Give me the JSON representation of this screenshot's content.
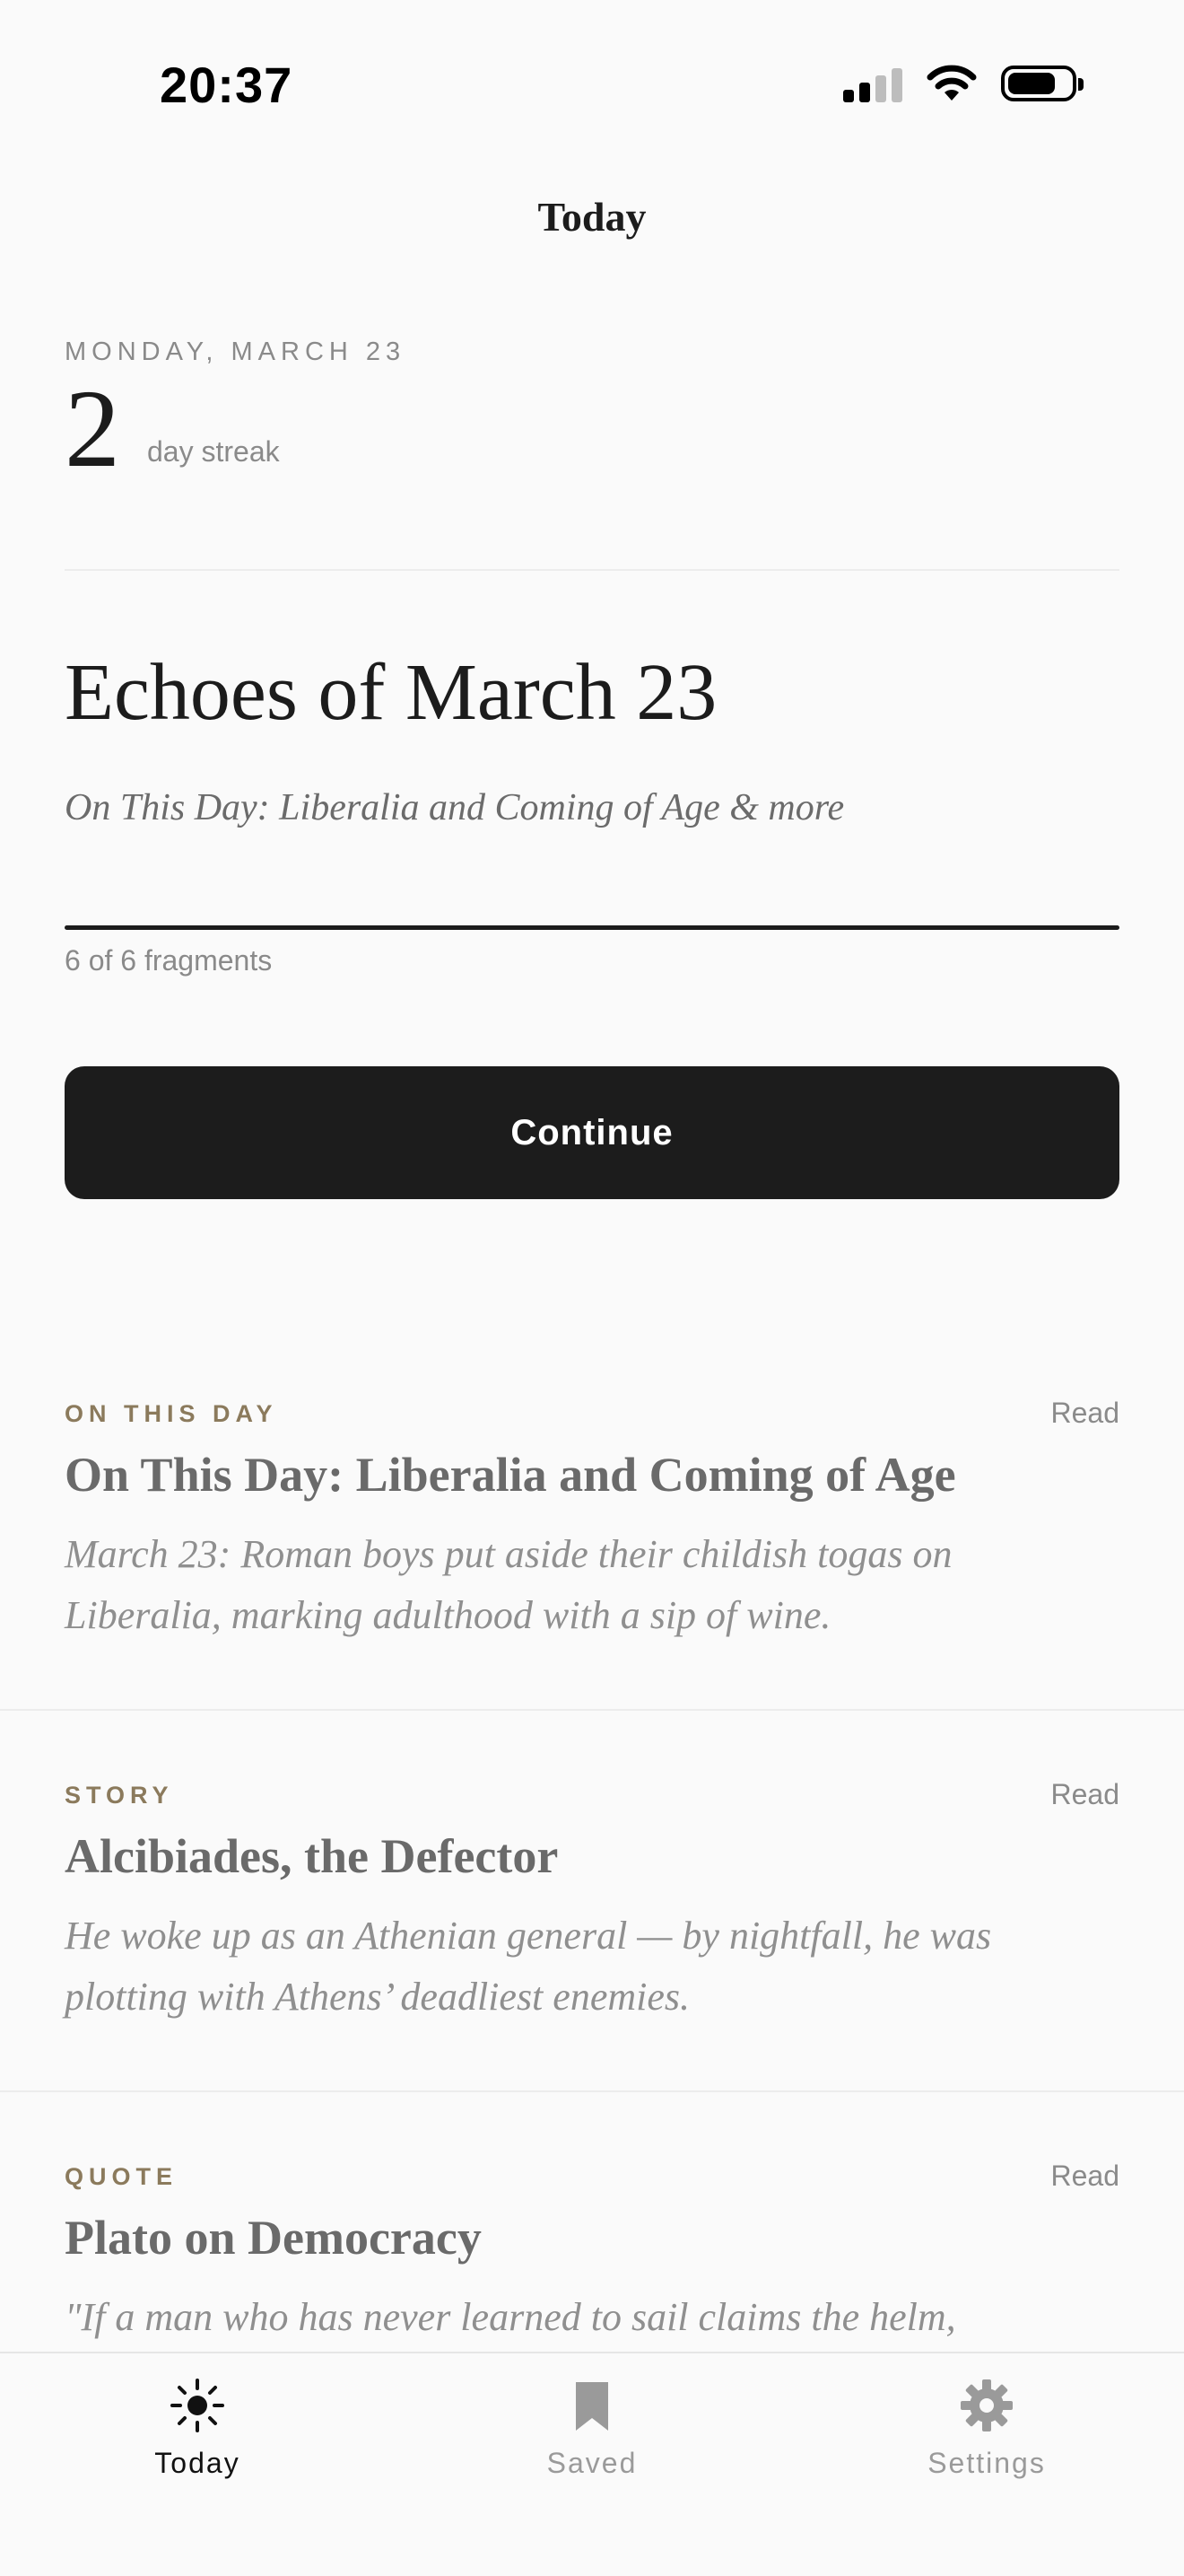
{
  "status_bar": {
    "time": "20:37"
  },
  "nav": {
    "title": "Today"
  },
  "header": {
    "date_label": "MONDAY, MARCH 23",
    "streak_count": "2",
    "streak_label": "day streak"
  },
  "echo": {
    "title": "Echoes of March 23",
    "subtitle": "On This Day: Liberalia and Coming of Age & more",
    "progress_fraction": 1.0,
    "progress_label": "6 of 6 fragments",
    "continue_label": "Continue"
  },
  "cards": [
    {
      "category": "ON THIS DAY",
      "read_label": "Read",
      "title": "On This Day: Liberalia and Coming of Age",
      "description": "March 23: Roman boys put aside their childish togas on Liberalia, marking adulthood with a sip of wine."
    },
    {
      "category": "STORY",
      "read_label": "Read",
      "title": "Alcibiades, the Defector",
      "description": "He woke up as an Athenian general — by nightfall, he was plotting with Athens’ deadliest enemies."
    },
    {
      "category": "QUOTE",
      "read_label": "Read",
      "title": "Plato on Democracy",
      "description": "\"If a man who has never learned to sail claims the helm,"
    }
  ],
  "tabbar": {
    "items": [
      {
        "label": "Today",
        "icon": "sun-icon",
        "active": true
      },
      {
        "label": "Saved",
        "icon": "bookmark-icon",
        "active": false
      },
      {
        "label": "Settings",
        "icon": "gear-icon",
        "active": false
      }
    ]
  },
  "colors": {
    "background": "#fafafa",
    "ink": "#1c1c1c",
    "category_accent": "#8b7a5c",
    "muted": "#8a8a8a"
  }
}
